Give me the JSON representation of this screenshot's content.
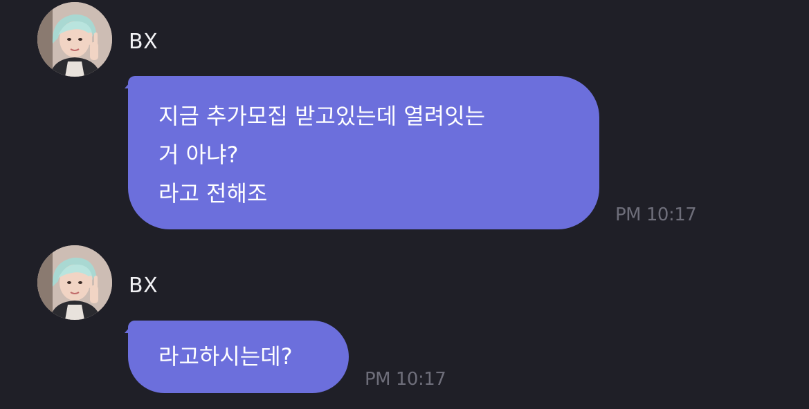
{
  "messages": [
    {
      "sender": "BX",
      "lines": [
        "지금 추가모집 받고있는데 열려잇는",
        "거 아냐?",
        "라고 전해조"
      ],
      "time": "PM 10:17"
    },
    {
      "sender": "BX",
      "lines": [
        "라고하시는데?"
      ],
      "time": "PM 10:17"
    }
  ],
  "colors": {
    "background": "#1f1f27",
    "bubble": "#6c6fdc",
    "timestamp": "#6e6e7a",
    "name": "#f2f2f5"
  }
}
